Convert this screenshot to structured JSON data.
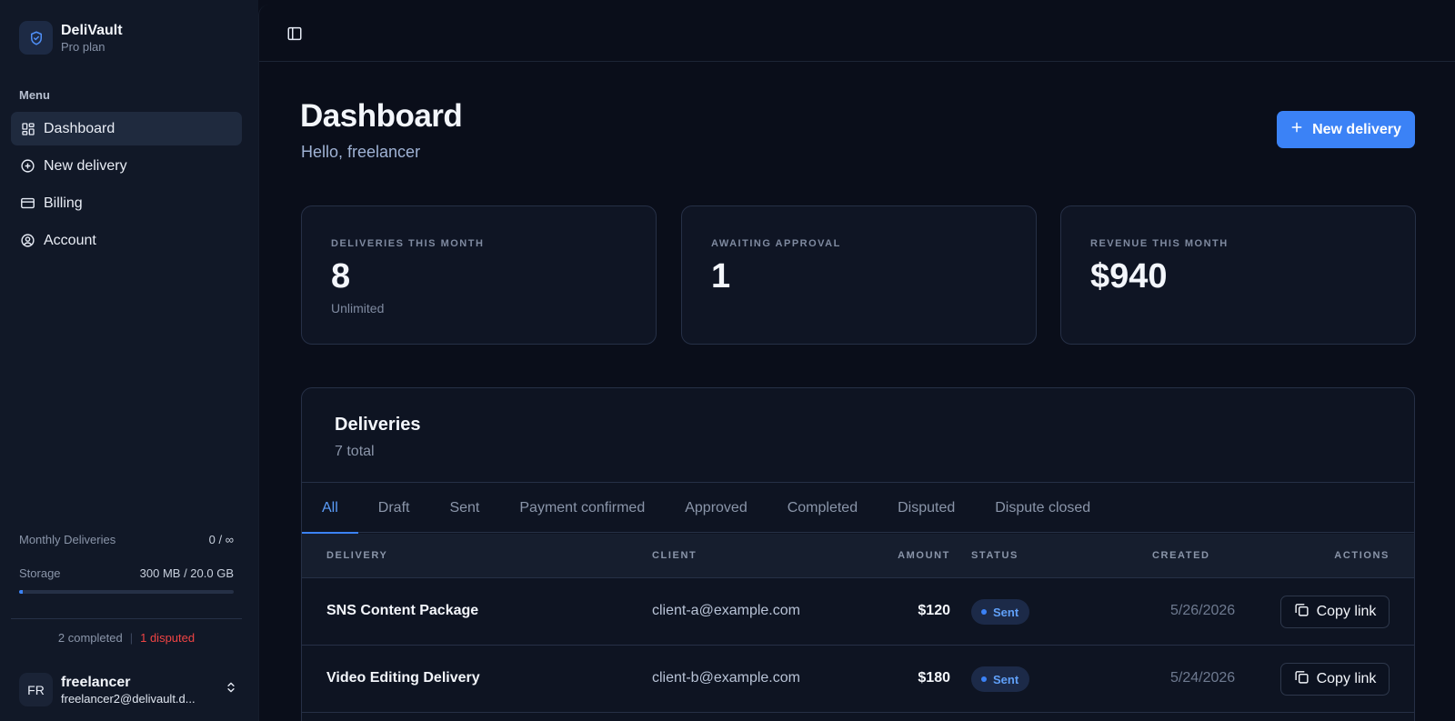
{
  "app": {
    "name": "DeliVault",
    "plan": "Pro plan"
  },
  "sidebar": {
    "menu_label": "Menu",
    "items": [
      {
        "label": "Dashboard",
        "icon": "dashboard-icon",
        "active": true
      },
      {
        "label": "New delivery",
        "icon": "plus-circle-icon",
        "active": false
      },
      {
        "label": "Billing",
        "icon": "credit-card-icon",
        "active": false
      },
      {
        "label": "Account",
        "icon": "user-circle-icon",
        "active": false
      }
    ],
    "usage": {
      "monthly_label": "Monthly Deliveries",
      "monthly_value": "0 / ∞",
      "storage_label": "Storage",
      "storage_value": "300 MB / 20.0 GB",
      "storage_fraction": 0.015
    },
    "summary": {
      "completed": "2 completed",
      "separator": "|",
      "disputed": "1 disputed"
    },
    "user": {
      "initials": "FR",
      "name": "freelancer",
      "email": "freelancer2@delivault.d..."
    }
  },
  "header": {
    "title": "Dashboard",
    "greeting": "Hello, freelancer",
    "new_button": "New delivery"
  },
  "stats": [
    {
      "label": "DELIVERIES THIS MONTH",
      "value": "8",
      "sub": "Unlimited"
    },
    {
      "label": "AWAITING APPROVAL",
      "value": "1",
      "sub": ""
    },
    {
      "label": "REVENUE THIS MONTH",
      "value": "$940",
      "sub": ""
    }
  ],
  "deliveries": {
    "title": "Deliveries",
    "subtitle": "7 total",
    "tabs": [
      "All",
      "Draft",
      "Sent",
      "Payment confirmed",
      "Approved",
      "Completed",
      "Disputed",
      "Dispute closed"
    ],
    "active_tab": "All",
    "columns": {
      "delivery": "DELIVERY",
      "client": "CLIENT",
      "amount": "AMOUNT",
      "status": "STATUS",
      "created": "CREATED",
      "actions": "ACTIONS"
    },
    "rows": [
      {
        "name": "SNS Content Package",
        "client": "client-a@example.com",
        "amount": "$120",
        "status": "Sent",
        "created": "5/26/2026",
        "action": "Copy link"
      },
      {
        "name": "Video Editing Delivery",
        "client": "client-b@example.com",
        "amount": "$180",
        "status": "Sent",
        "created": "5/24/2026",
        "action": "Copy link"
      }
    ]
  },
  "colors": {
    "accent": "#3b82f6",
    "background": "#0a0e1a",
    "sidebar": "#111827",
    "danger": "#ef4444"
  }
}
